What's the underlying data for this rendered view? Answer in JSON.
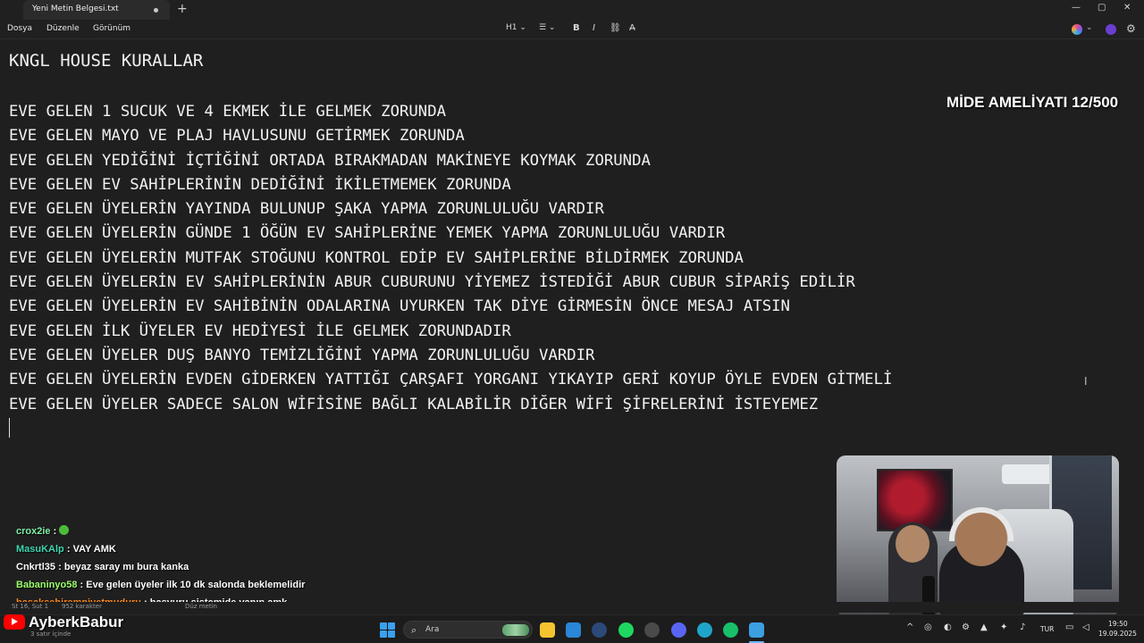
{
  "tab": {
    "title": "Yeni Metin Belgesi.txt",
    "add": "+"
  },
  "window_controls": {
    "minimize": "—",
    "maximize": "▢",
    "close": "✕"
  },
  "menu": {
    "items": [
      "Dosya",
      "Düzenle",
      "Görünüm"
    ]
  },
  "format_bar": {
    "heading": "H1 ⌄",
    "list": "☰ ⌄",
    "bold": "B",
    "italic": "I",
    "link": "⛓",
    "clear": "A̶"
  },
  "document": {
    "title": "KNGL HOUSE KURALLAR",
    "rules": [
      "EVE GELEN 1 SUCUK VE 4 EKMEK İLE GELMEK ZORUNDA",
      "EVE GELEN MAYO VE PLAJ HAVLUSUNU GETİRMEK ZORUNDA",
      "EVE GELEN YEDİĞİNİ İÇTİĞİNİ ORTADA BIRAKMADAN MAKİNEYE KOYMAK ZORUNDA",
      "EVE GELEN EV SAHİPLERİNİN DEDİĞİNİ İKİLETMEMEK ZORUNDA",
      "EVE GELEN ÜYELERİN YAYINDA BULUNUP ŞAKA YAPMA ZORUNLULUĞU VARDIR",
      "EVE GELEN ÜYELERİN GÜNDE 1 ÖĞÜN EV SAHİPLERİNE YEMEK YAPMA ZORUNLULUĞU VARDIR",
      "EVE GELEN ÜYELERİN MUTFAK STOĞUNU KONTROL EDİP EV SAHİPLERİNE BİLDİRMEK ZORUNDA",
      "EVE GELEN ÜYELERİN EV SAHİPLERİNİN ABUR CUBURUNU YİYEMEZ İSTEDİĞİ ABUR CUBUR SİPARİŞ EDİLİR",
      "EVE GELEN ÜYELERİN EV SAHİBİNİN ODALARINA UYURKEN TAK DİYE GİRMESİN ÖNCE MESAJ ATSIN",
      "EVE GELEN İLK ÜYELER EV HEDİYESİ İLE GELMEK ZORUNDADIR",
      "EVE GELEN ÜYELER DUŞ BANYO TEMİZLİĞİNİ YAPMA ZORUNLULUĞU VARDIR",
      "EVE GELEN ÜYELERİN EVDEN GİDERKEN YATTIĞI ÇARŞAFI YORGANI YIKAYIP GERİ KOYUP ÖYLE EVDEN GİTMELİ",
      "EVE GELEN ÜYELER SADECE SALON WİFİSİNE BAĞLI KALABİLİR DİĞER WİFİ ŞİFRELERİNİ İSTEYEMEZ"
    ]
  },
  "overlay": {
    "text": "MİDE AMELİYATI 12/500"
  },
  "chat": {
    "messages": [
      {
        "user": "crox2ie",
        "color": "#7ff0a8",
        "text": ""
      },
      {
        "user": "MasuKAlp",
        "color": "#3fd6b0",
        "text": "VAY AMK"
      },
      {
        "user": "Cnkrtl35",
        "color": "#ffffff",
        "text": "beyaz saray mı bura kanka"
      },
      {
        "user": "Babaninyo58",
        "color": "#9dff6a",
        "text": "Eve gelen üyeler ilk 10 dk salonda beklemelidir"
      },
      {
        "user": "basaksehiremniyetmuduru",
        "color": "#ff8a1c",
        "text": "başvuru sistemide yapın amk"
      }
    ]
  },
  "status_bar": {
    "position": "St 16, Sut 1",
    "chars": "952 karakter",
    "mode": "Düz metin",
    "lines": "3 satır içinde"
  },
  "brand": {
    "name": "AyberkBabur"
  },
  "taskbar": {
    "search_label": "Ara",
    "search_icon": "⌕",
    "language": "TUR",
    "time": "19:50",
    "date": "19.09.2025",
    "colors": {
      "explorer": "#f4c430",
      "store": "#2a86d6",
      "steam": "#2b4a7a",
      "spotify": "#1ed760",
      "obs": "#4a4a4a",
      "discord": "#5865f2",
      "edge": "#1fa5c9",
      "app": "#18c06a",
      "notepad": "#3c9fe0"
    }
  }
}
